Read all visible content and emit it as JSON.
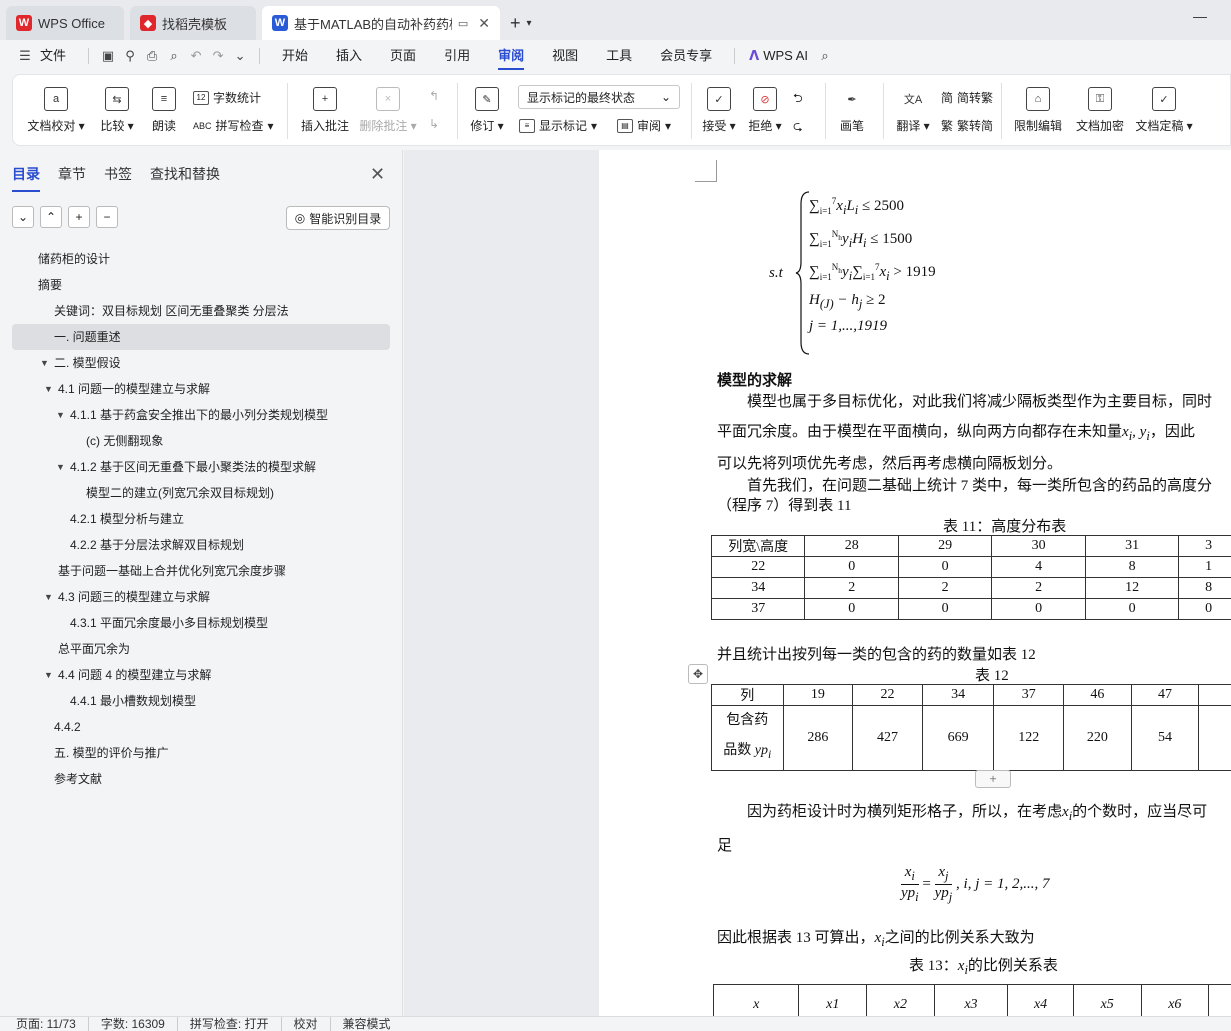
{
  "tabs": [
    {
      "label": "WPS Office",
      "icon": "wps-logo-icon",
      "color": "#e0282c"
    },
    {
      "label": "找稻壳模板",
      "icon": "docer-icon",
      "color": "#e0282c"
    },
    {
      "label": "基于MATLAB的自动补药药柜设",
      "icon": "word-doc-icon",
      "color": "#2a5bd7"
    }
  ],
  "menu": {
    "file": "文件",
    "items": [
      "开始",
      "插入",
      "页面",
      "引用",
      "审阅",
      "视图",
      "工具",
      "会员专享"
    ],
    "active": "审阅",
    "wps_ai": "WPS AI"
  },
  "ribbon": {
    "doc_check": "文档校对",
    "compare": "比较",
    "read_aloud": "朗读",
    "word_count": "字数统计",
    "spell_check": "拼写检查",
    "insert_comment": "插入批注",
    "delete_comment": "删除批注",
    "revise": "修订",
    "markup_select": "显示标记的最终状态",
    "show_markup": "显示标记",
    "review": "审阅",
    "accept": "接受",
    "reject": "拒绝",
    "pen": "画笔",
    "translate": "翻译",
    "to_traditional": "简转繁",
    "to_simplified": "繁转简",
    "restrict_edit": "限制编辑",
    "encrypt": "文档加密",
    "finalize": "文档定稿"
  },
  "sidebar": {
    "tabs": [
      "目录",
      "章节",
      "书签",
      "查找和替换"
    ],
    "active_tab": "目录",
    "smart_toc": "智能识别目录",
    "toc": [
      {
        "label": "储药柜的设计",
        "indent": 0,
        "twisty": ""
      },
      {
        "label": "摘要",
        "indent": 0,
        "twisty": ""
      },
      {
        "label": "关键词：双目标规划  区间无重叠聚类  分层法",
        "indent": 1,
        "twisty": ""
      },
      {
        "label": "一. 问题重述",
        "indent": 1,
        "twisty": "",
        "selected": true
      },
      {
        "label": "二. 模型假设",
        "indent": 1,
        "twisty": "▼"
      },
      {
        "label": "4.1  问题一的模型建立与求解",
        "indent": 2,
        "twisty": "▼"
      },
      {
        "label": "4.1.1  基于药盒安全推出下的最小列分类规划模型",
        "indent": 3,
        "twisty": "▼"
      },
      {
        "label": "(c)  无侧翻现象",
        "indent": 4,
        "twisty": ""
      },
      {
        "label": "4.1.2     基于区间无重叠下最小聚类法的模型求解",
        "indent": 3,
        "twisty": "▼"
      },
      {
        "label": "模型二的建立(列宽冗余双目标规划)",
        "indent": 4,
        "twisty": ""
      },
      {
        "label": "4.2.1 模型分析与建立",
        "indent": 3,
        "twisty": ""
      },
      {
        "label": "4.2.2  基于分层法求解双目标规划",
        "indent": 3,
        "twisty": ""
      },
      {
        "label": "基于问题一基础上合并优化列宽冗余度步骤",
        "indent": 2,
        "twisty": ""
      },
      {
        "label": "4.3  问题三的模型建立与求解",
        "indent": 2,
        "twisty": "▼"
      },
      {
        "label": "4.3.1  平面冗余度最小多目标规划模型",
        "indent": 3,
        "twisty": ""
      },
      {
        "label": "总平面冗余为",
        "indent": 2,
        "twisty": ""
      },
      {
        "label": "4.4  问题 4 的模型建立与求解",
        "indent": 2,
        "twisty": "▼"
      },
      {
        "label": "4.4.1  最小槽数规划模型",
        "indent": 3,
        "twisty": ""
      },
      {
        "label": "4.4.2",
        "indent": 1,
        "twisty": ""
      },
      {
        "label": "五. 模型的评价与推广",
        "indent": 1,
        "twisty": ""
      },
      {
        "label": "参考文献",
        "indent": 1,
        "twisty": ""
      }
    ]
  },
  "doc": {
    "st_label": "s.t",
    "eq1": "≤ 2500",
    "eq2": "≤ 1500",
    "eq3": "> 1919",
    "eq4": "≥ 2",
    "eq5": "j = 1,...,1919",
    "heading_solve": "模型的求解",
    "p1": "模型也属于多目标优化，对此我们将减少隔板类型作为主要目标，同时",
    "p1b_pre": "平面冗余度。由于模型在平面横向，纵向两方向都存在未知量",
    "p1b_post": "，因此",
    "p1c": "可以先将列项优先考虑，然后再考虑横向隔板划分。",
    "p2": "首先我们，在问题二基础上统计 7 类中，每一类所包含的药品的高度分",
    "p2b": "（程序 7）得到表 11",
    "table11_title": "表 11：高度分布表",
    "table11": [
      [
        "列宽\\高度",
        "28",
        "29",
        "30",
        "31",
        "3"
      ],
      [
        "22",
        "0",
        "0",
        "4",
        "8",
        "1"
      ],
      [
        "34",
        "2",
        "2",
        "2",
        "12",
        "8"
      ],
      [
        "37",
        "0",
        "0",
        "0",
        "0",
        "0"
      ]
    ],
    "p3": "并且统计出按列每一类的包含的药的数量如表 12",
    "table12_title": "表 12",
    "table12_head": [
      "列",
      "19",
      "22",
      "34",
      "37",
      "46",
      "47",
      ""
    ],
    "table12_row_label1": "包含药",
    "table12_row_label2": "品数 ",
    "table12_row_var": "yp",
    "table12_values": [
      "286",
      "427",
      "669",
      "122",
      "220",
      "54",
      ""
    ],
    "p4": "因为药柜设计时为横列矩形格子，所以，在考虑",
    "p4_post": "的个数时，应当尽可",
    "p4b": "足",
    "ratio_eq": "i, j = 1, 2,..., 7",
    "p5_pre": "因此根据表 13 可算出，",
    "p5_post": "之间的比例关系大致为",
    "table13_title_pre": "表 13：",
    "table13_title_post": "的比例关系表",
    "table13_head": [
      "x",
      "x1",
      "x2",
      "x3",
      "x4",
      "x5",
      "x6",
      ""
    ]
  },
  "status": {
    "page": "页面: 11/73",
    "words": "字数: 16309",
    "spell": "拼写检查: 打开",
    "proof": "校对",
    "compat": "兼容模式"
  }
}
